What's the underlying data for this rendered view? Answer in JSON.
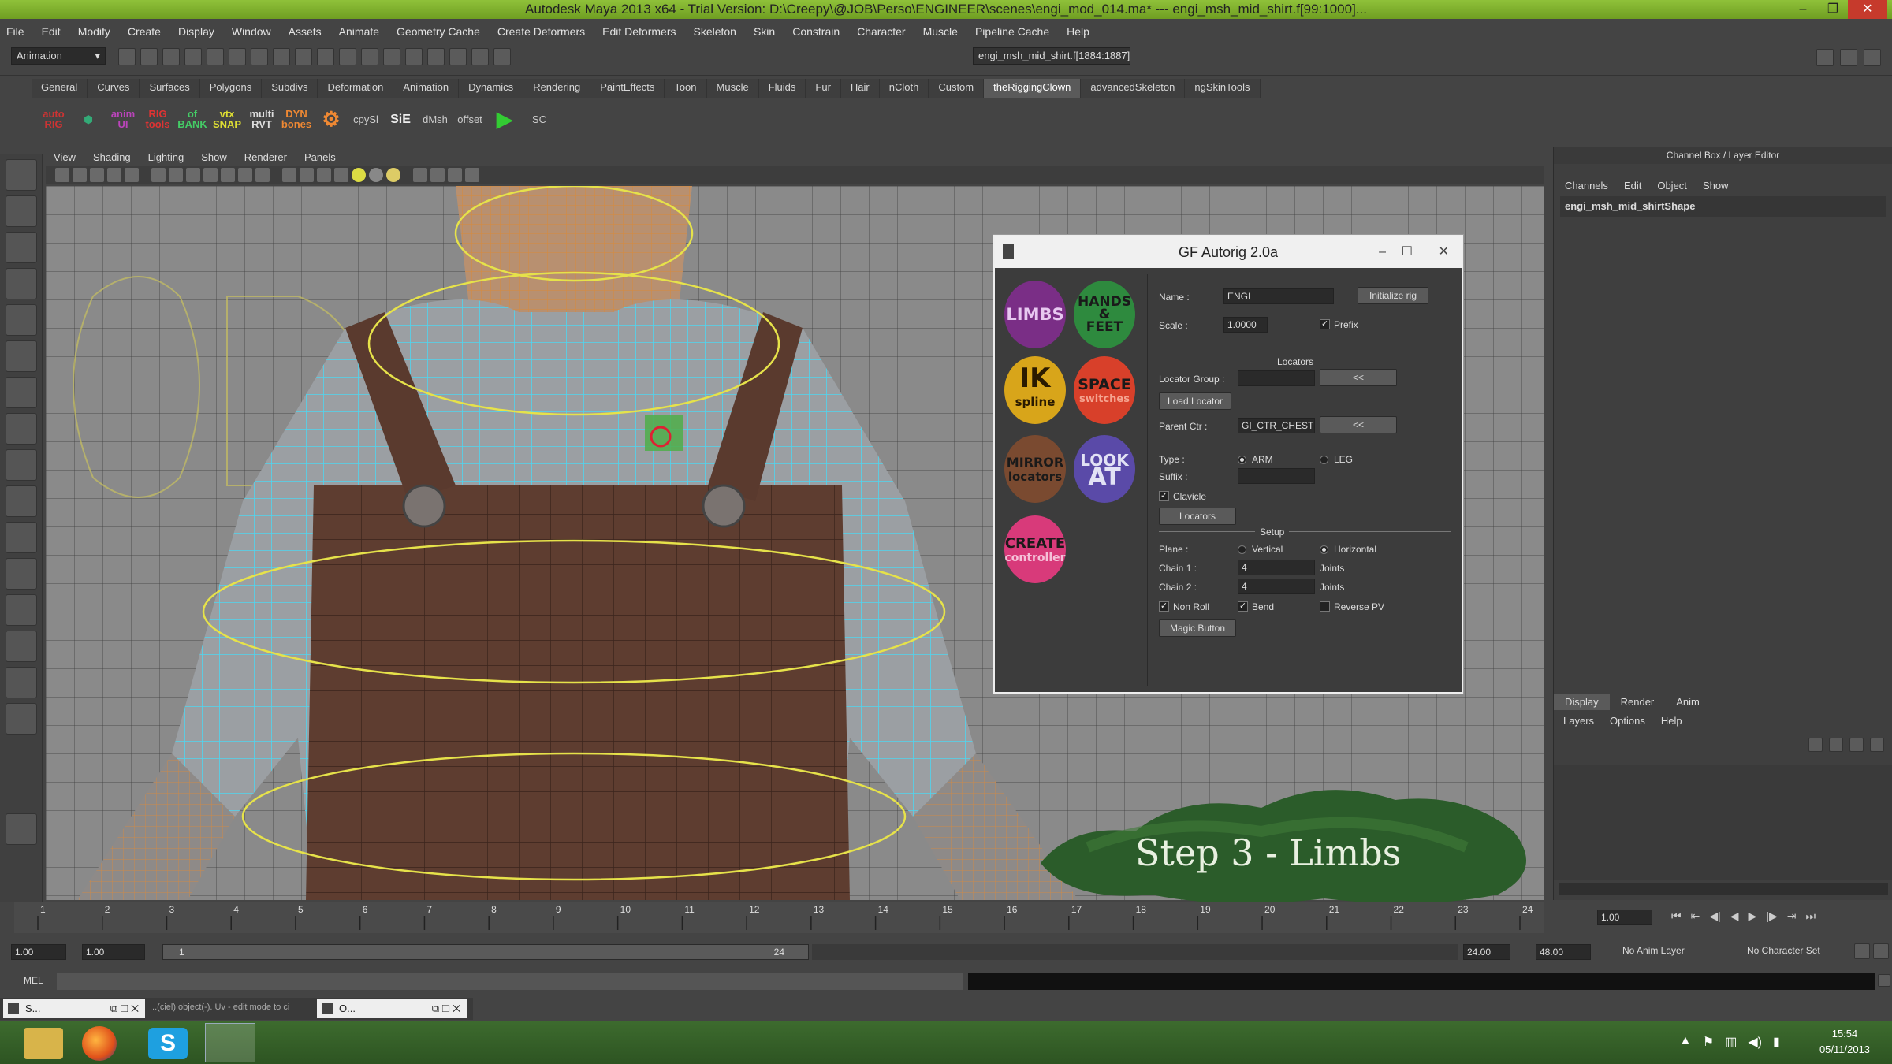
{
  "title_bar": {
    "text": "Autodesk Maya 2013 x64 - Trial Version: D:\\Creepy\\@JOB\\Perso\\ENGINEER\\scenes\\engi_mod_014.ma*   ---   engi_msh_mid_shirt.f[99:1000]..."
  },
  "menu": [
    "File",
    "Edit",
    "Modify",
    "Create",
    "Display",
    "Window",
    "Assets",
    "Animate",
    "Geometry Cache",
    "Create Deformers",
    "Edit Deformers",
    "Skeleton",
    "Skin",
    "Constrain",
    "Character",
    "Muscle",
    "Pipeline Cache",
    "Help"
  ],
  "status_line": {
    "mode": "Animation",
    "selection_field": "engi_msh_mid_shirt.f[1884:1887]"
  },
  "shelf_tabs": [
    "General",
    "Curves",
    "Surfaces",
    "Polygons",
    "Subdivs",
    "Deformation",
    "Animation",
    "Dynamics",
    "Rendering",
    "PaintEffects",
    "Toon",
    "Muscle",
    "Fluids",
    "Fur",
    "Hair",
    "nCloth",
    "Custom",
    "theRiggingClown",
    "advancedSkeleton",
    "ngSkinTools"
  ],
  "shelf_active_tab": "theRiggingClown",
  "shelf_icons": [
    {
      "label": "auto RIG",
      "icon": "autorig-icon",
      "color": "#b33"
    },
    {
      "label": "",
      "icon": "green-shield-icon",
      "color": "#3a7"
    },
    {
      "label": "anim UI",
      "icon": "anim-ui-icon",
      "color": "#a3a"
    },
    {
      "label": "RIG tools",
      "icon": "rig-tools-icon",
      "color": "#c33"
    },
    {
      "label": "of BANK",
      "icon": "bank-icon",
      "color": "#3b6"
    },
    {
      "label": "vtx SNAP",
      "icon": "snap-icon",
      "color": "#cc3"
    },
    {
      "label": "multi RVT",
      "icon": "rvt-icon",
      "color": "#ccc"
    },
    {
      "label": "DYN bones",
      "icon": "dyn-bones-icon",
      "color": "#e83"
    },
    {
      "label": "",
      "icon": "orange-gear-icon",
      "color": "#e83"
    },
    {
      "label": "cpySl",
      "icon": "copy-skin-icon",
      "color": "#bbb"
    },
    {
      "label": "SiE",
      "icon": "sie-icon",
      "color": "#ddd"
    },
    {
      "label": "dMsh",
      "icon": "dmsh-icon",
      "color": "#bbb"
    },
    {
      "label": "offset",
      "icon": "offset-icon",
      "color": "#bbb"
    },
    {
      "label": "",
      "icon": "play-icon",
      "color": "#3c3"
    },
    {
      "label": "SC",
      "icon": "sc-icon",
      "color": "#bbb"
    }
  ],
  "panel_menu": [
    "View",
    "Shading",
    "Lighting",
    "Show",
    "Renderer",
    "Panels"
  ],
  "autorig": {
    "title": "GF Autorig 2.0a",
    "modules": [
      {
        "top": "LIMBS",
        "bottom": "",
        "color": "#7a2e86"
      },
      {
        "top": "HANDS",
        "mid": "&",
        "bottom": "FEET",
        "color": "#2e8a3e"
      },
      {
        "top": "IK",
        "bottom": "spline",
        "color": "#d8a51a"
      },
      {
        "top": "SPACE",
        "bottom": "switches",
        "color": "#d8402a"
      },
      {
        "top": "MIRROR",
        "bottom": "locators",
        "color": "#7a4a30"
      },
      {
        "top": "LOOK",
        "bottom": "AT",
        "color": "#5a4aa8"
      },
      {
        "top": "CREATE",
        "bottom": "controller",
        "color": "#d83a7a"
      }
    ],
    "name_label": "Name :",
    "name_value": "ENGI",
    "init_button": "Initialize rig",
    "scale_label": "Scale :",
    "scale_value": "1.0000",
    "prefix_label": "Prefix",
    "locators_header": "Locators",
    "locator_group_label": "Locator Group :",
    "load_locator_button": "Load Locator",
    "parent_ctr_label": "Parent Ctr :",
    "parent_ctr_value": "GI_CTR_CHEST",
    "arrow_button": "<<",
    "type_label": "Type :",
    "type_arm": "ARM",
    "type_leg": "LEG",
    "suffix_label": "Suffix :",
    "clavicle_label": "Clavicle",
    "locators_button": "Locators",
    "setup_header": "Setup",
    "plane_label": "Plane :",
    "plane_vertical": "Vertical",
    "plane_horizontal": "Horizontal",
    "chain1_label": "Chain 1 :",
    "chain1_value": "4",
    "chain2_label": "Chain 2 :",
    "chain2_value": "4",
    "joints_label": "Joints",
    "non_roll_label": "Non Roll",
    "bend_label": "Bend",
    "reverse_pv_label": "Reverse PV",
    "magic_button": "Magic Button"
  },
  "banner": {
    "text": "Step 3 - Limbs"
  },
  "channel_box": {
    "header": "Channel Box / Layer Editor",
    "menu": [
      "Channels",
      "Edit",
      "Object",
      "Show"
    ],
    "object_name": "engi_msh_mid_shirtShape"
  },
  "layer_editor": {
    "tabs": [
      "Display",
      "Render",
      "Anim"
    ],
    "menu": [
      "Layers",
      "Options",
      "Help"
    ]
  },
  "time_slider": {
    "ticks": [
      "1",
      "2",
      "3",
      "4",
      "5",
      "6",
      "7",
      "8",
      "9",
      "10",
      "11",
      "12",
      "13",
      "14",
      "15",
      "16",
      "17",
      "18",
      "19",
      "20",
      "21",
      "22",
      "23",
      "24"
    ],
    "current_frame": "1.00"
  },
  "range_slider": {
    "start": "1.00",
    "inner_start": "1.00",
    "range_start_label": "1",
    "range_end_label": "24",
    "end": "24.00",
    "outer_end": "48.00",
    "anim_layer": "No Anim Layer",
    "character_set": "No Character Set"
  },
  "mel": {
    "label": "MEL"
  },
  "min_windows": [
    {
      "label": "S...",
      "icon": "script-icon"
    },
    {
      "label": "O...",
      "icon": "outliner-icon"
    }
  ],
  "min_windows_text": "...(ciel) object(-). Uv - edit mode to ci",
  "taskbar": {
    "apps": [
      "explorer-icon",
      "firefox-icon",
      "skype-icon",
      "maya-icon"
    ],
    "time": "15:54",
    "date": "05/11/2013"
  }
}
